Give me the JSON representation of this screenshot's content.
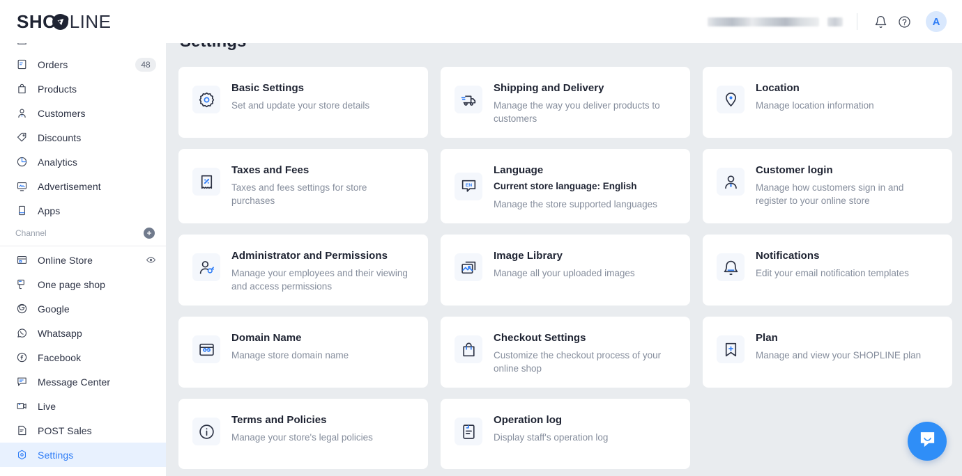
{
  "header": {
    "logo_shop": "SHOP",
    "logo_line": "LINE",
    "store_name_redacted": "",
    "notifications_icon": "bell-icon",
    "help_icon": "help-circle-icon",
    "avatar_initial": "A"
  },
  "sidebar": {
    "items": [
      {
        "label": "Orders",
        "icon": "orders-icon",
        "badge": "48"
      },
      {
        "label": "Products",
        "icon": "products-bag-icon"
      },
      {
        "label": "Customers",
        "icon": "customers-person-icon"
      },
      {
        "label": "Discounts",
        "icon": "discount-tag-icon"
      },
      {
        "label": "Analytics",
        "icon": "analytics-pie-icon"
      },
      {
        "label": "Advertisement",
        "icon": "advertisement-screen-icon"
      },
      {
        "label": "Apps",
        "icon": "apps-device-icon"
      }
    ],
    "section_label": "Channel",
    "section_add_icon": "plus-circle-icon",
    "channel_items": [
      {
        "label": "Online Store",
        "icon": "online-store-icon",
        "trailing_icon": "eye-icon"
      },
      {
        "label": "One page shop",
        "icon": "one-page-shop-icon"
      },
      {
        "label": "Google",
        "icon": "google-icon"
      },
      {
        "label": "Whatsapp",
        "icon": "whatsapp-icon"
      },
      {
        "label": "Facebook",
        "icon": "facebook-icon"
      },
      {
        "label": "Message Center",
        "icon": "message-center-icon"
      },
      {
        "label": "Live",
        "icon": "live-video-icon"
      },
      {
        "label": "POST Sales",
        "icon": "post-sales-doc-icon"
      },
      {
        "label": "Settings",
        "icon": "settings-gear-icon",
        "active": true
      }
    ]
  },
  "main": {
    "page_title": "Settings",
    "cards": [
      {
        "title": "Basic Settings",
        "desc": "Set and update your store details",
        "icon": "gear-icon"
      },
      {
        "title": "Shipping and Delivery",
        "desc": "Manage the way you deliver products to customers",
        "icon": "truck-icon"
      },
      {
        "title": "Location",
        "desc": "Manage location information",
        "icon": "map-pin-icon"
      },
      {
        "title": "Taxes and Fees",
        "desc": "Taxes and fees settings for store purchases",
        "icon": "receipt-percent-icon"
      },
      {
        "title": "Language",
        "strong": "Current store language: English",
        "desc": "Manage the store supported languages",
        "icon": "language-en-icon"
      },
      {
        "title": "Customer login",
        "desc": "Manage how customers sign in and register to your online store",
        "icon": "user-icon"
      },
      {
        "title": "Administrator and Permissions",
        "desc": "Manage your employees and their viewing and access permissions",
        "icon": "user-key-icon"
      },
      {
        "title": "Image Library",
        "desc": "Manage all your uploaded images",
        "icon": "image-icon"
      },
      {
        "title": "Notifications",
        "desc": "Edit your email notification templates",
        "icon": "bell-icon"
      },
      {
        "title": "Domain Name",
        "desc": "Manage store domain name",
        "icon": "domain-link-icon"
      },
      {
        "title": "Checkout Settings",
        "desc": "Customize the checkout process of your online shop",
        "icon": "shopping-bag-icon"
      },
      {
        "title": "Plan",
        "desc": "Manage and view your SHOPLINE plan",
        "icon": "bookmark-plus-icon"
      },
      {
        "title": "Terms and Policies",
        "desc": "Manage your store's legal policies",
        "icon": "info-circle-icon"
      },
      {
        "title": "Operation log",
        "desc": "Display staff's operation log",
        "icon": "log-document-icon"
      }
    ]
  },
  "chat_widget": {
    "icon": "chat-bubble-icon"
  },
  "colors": {
    "accent": "#2f7df6",
    "page_bg": "#e9ecef",
    "card_bg": "#ffffff",
    "text": "#1e2332",
    "muted": "#858d9c"
  }
}
